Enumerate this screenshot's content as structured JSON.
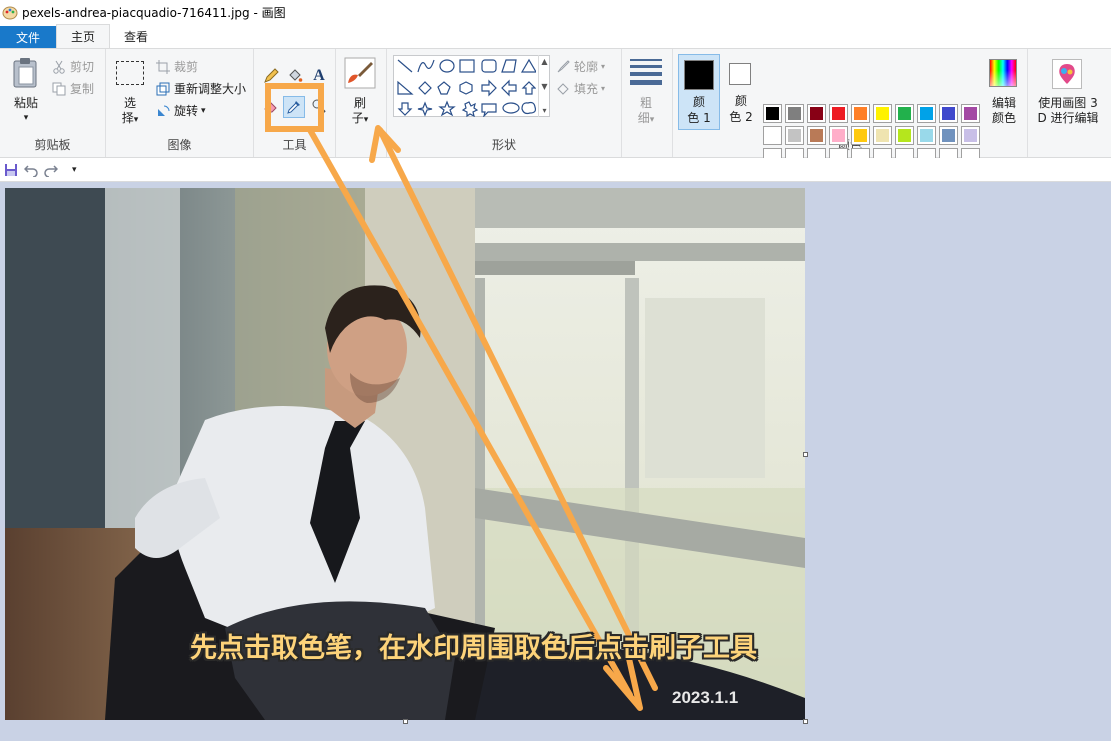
{
  "window": {
    "title": "pexels-andrea-piacquadio-716411.jpg - 画图"
  },
  "tabs": {
    "file": "文件",
    "home": "主页",
    "view": "查看"
  },
  "clipboard": {
    "paste_line1": "粘贴",
    "cut": "剪切",
    "copy": "复制",
    "label": "剪贴板"
  },
  "image": {
    "select_line1": "选",
    "select_line2": "择",
    "crop": "裁剪",
    "resize": "重新调整大小",
    "rotate": "旋转",
    "label": "图像"
  },
  "tools": {
    "label": "工具",
    "text_glyph": "A"
  },
  "brushes": {
    "line1": "刷",
    "line2": "子"
  },
  "shapes": {
    "outline": "轮廓",
    "fill": "填充",
    "label": "形状"
  },
  "size": {
    "line1": "粗",
    "line2": "细"
  },
  "colors": {
    "color1_line1": "颜",
    "color1_line2": "色 1",
    "color2_line1": "颜",
    "color2_line2": "色 2",
    "edit_line1": "编辑",
    "edit_line2": "颜色",
    "label": "颜色",
    "palette_row1": [
      "#000000",
      "#7f7f7f",
      "#880015",
      "#ed1c24",
      "#ff7f27",
      "#fff200",
      "#22b14c",
      "#00a2e8",
      "#3f48cc",
      "#a349a4"
    ],
    "palette_row2": [
      "#ffffff",
      "#c3c3c3",
      "#b97a57",
      "#ffaec9",
      "#ffc90e",
      "#efe4b0",
      "#b5e61d",
      "#99d9ea",
      "#7092be",
      "#c8bfe7"
    ],
    "color1": "#000000",
    "color2": "#ffffff"
  },
  "paint3d": {
    "line1": "使用画图 3",
    "line2": "D 进行编辑"
  },
  "annotation": {
    "caption": "先点击取色笔，在水印周围取色后点击刷子工具",
    "highlight_color": "#f7a84a"
  },
  "photo": {
    "watermark": "2023.1.1"
  }
}
